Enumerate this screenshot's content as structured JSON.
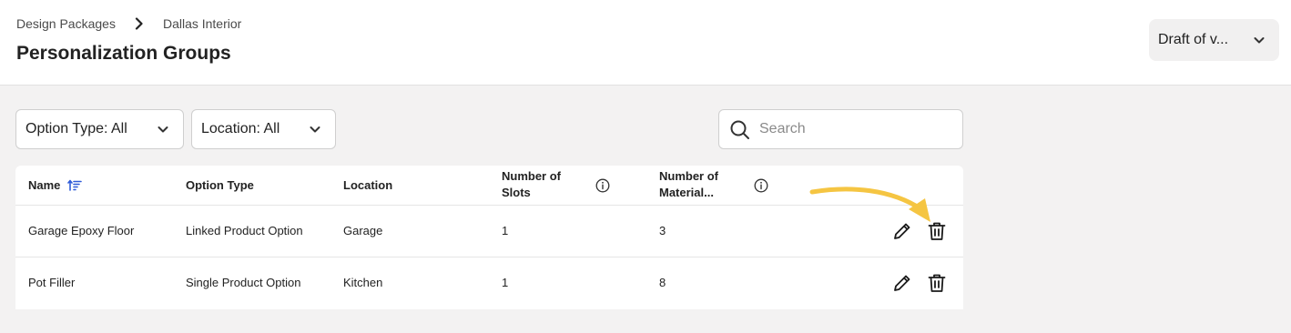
{
  "breadcrumb": {
    "parent": "Design Packages",
    "current": "Dallas Interior"
  },
  "page": {
    "title": "Personalization Groups"
  },
  "version_select": {
    "value": "Draft of v..."
  },
  "filters": {
    "option_type": "Option Type: All",
    "location": "Location: All"
  },
  "search": {
    "placeholder": "Search",
    "value": ""
  },
  "table": {
    "columns": {
      "name": "Name",
      "option_type": "Option Type",
      "location": "Location",
      "slots": "Number of Slots",
      "materials": "Number of Material..."
    },
    "rows": [
      {
        "name": "Garage Epoxy Floor",
        "option_type": "Linked Product Option",
        "location": "Garage",
        "slots": "1",
        "materials": "3"
      },
      {
        "name": "Pot Filler",
        "option_type": "Single Product Option",
        "location": "Kitchen",
        "slots": "1",
        "materials": "8"
      }
    ]
  },
  "icons": {
    "breadcrumb_separator": "chevron-right-icon",
    "dropdown": "chevron-down-icon",
    "search": "search-icon",
    "sort": "sort-ascending-icon",
    "info": "info-icon",
    "edit": "pencil-icon",
    "delete": "trash-icon"
  },
  "colors": {
    "accent": "#2f5bd8",
    "annotation_arrow": "#f5c542",
    "background": "#f3f2f2"
  }
}
